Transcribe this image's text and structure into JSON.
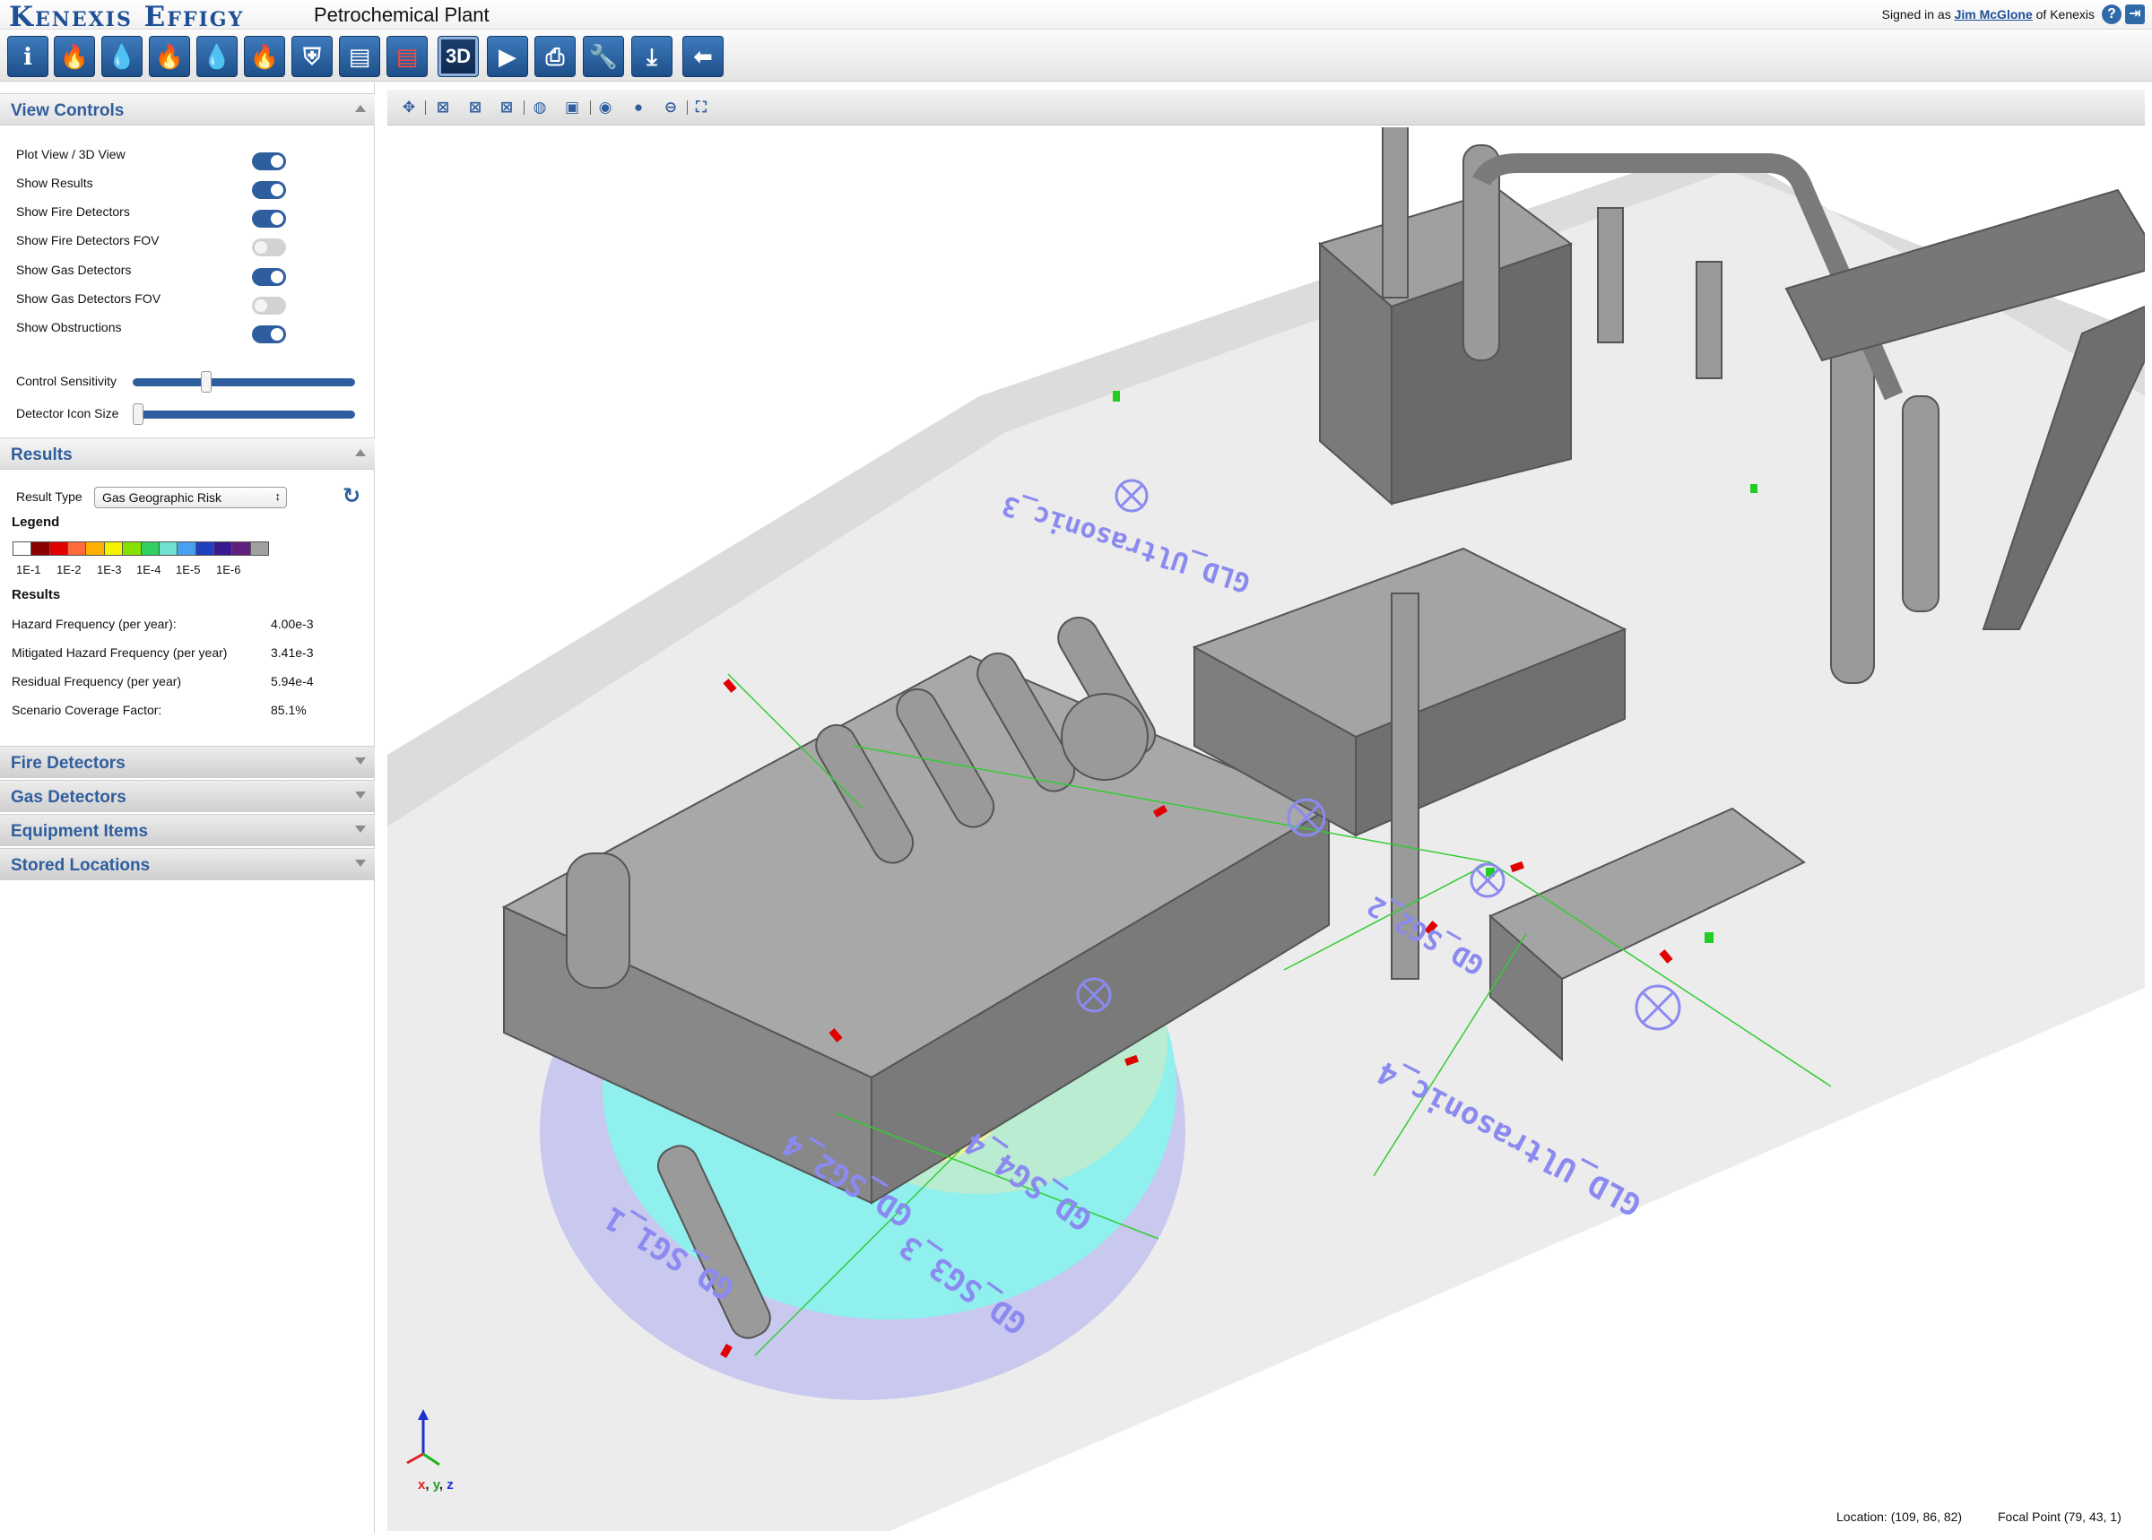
{
  "header": {
    "logo": "Kenexis Effigy",
    "app_title": "Petrochemical Plant",
    "signed_in_prefix": "Signed in as ",
    "user_name": "Jim McGlone",
    "signed_in_suffix": " of Kenexis",
    "help_icon": "?",
    "logout_icon": "⇥"
  },
  "toolbar": {
    "buttons": [
      {
        "name": "info-icon",
        "glyph": "ℹ"
      },
      {
        "name": "fire-circle-icon",
        "glyph": "🔥"
      },
      {
        "name": "gas-drop-icon",
        "glyph": "💧"
      },
      {
        "name": "fire-hazard-icon",
        "glyph": "🔥"
      },
      {
        "name": "gas-hazard-icon",
        "glyph": "💧"
      },
      {
        "name": "fire-map-icon",
        "glyph": "🔥"
      },
      {
        "name": "shield-icon",
        "glyph": "⛨"
      },
      {
        "name": "report-icon",
        "glyph": "▤"
      },
      {
        "name": "report-red-icon",
        "glyph": "▤"
      },
      {
        "name": "3d-view-icon",
        "glyph": "3D"
      },
      {
        "name": "play-icon",
        "glyph": "▶"
      },
      {
        "name": "print-icon",
        "glyph": "⎙"
      },
      {
        "name": "wrench-icon",
        "glyph": "🔧"
      },
      {
        "name": "download-icon",
        "glyph": "⤓"
      },
      {
        "name": "back-arrow-icon",
        "glyph": "⬅"
      }
    ]
  },
  "view_controls": {
    "title": "View Controls",
    "toggles": [
      {
        "label": "Plot View / 3D View",
        "on": true
      },
      {
        "label": "Show Results",
        "on": true
      },
      {
        "label": "Show Fire Detectors",
        "on": true
      },
      {
        "label": "Show Fire Detectors FOV",
        "on": false
      },
      {
        "label": "Show Gas Detectors",
        "on": true
      },
      {
        "label": "Show Gas Detectors FOV",
        "on": false
      },
      {
        "label": "Show Obstructions",
        "on": true
      }
    ],
    "control_sensitivity_label": "Control Sensitivity",
    "control_sensitivity_value": 0.32,
    "detector_icon_size_label": "Detector Icon Size",
    "detector_icon_size_value": 0.0
  },
  "results": {
    "title": "Results",
    "result_type_label": "Result Type",
    "result_type_value": "Gas Geographic Risk",
    "legend_title": "Legend",
    "legend_colors": [
      "#ffffff",
      "#8b0000",
      "#e00000",
      "#ff6a3c",
      "#ffb000",
      "#f3f300",
      "#88e000",
      "#30d060",
      "#70e0d0",
      "#4aa0f0",
      "#2040c0",
      "#3a1a90",
      "#602080",
      "#a0a0a0"
    ],
    "legend_ticks": [
      "1E-1",
      "1E-2",
      "1E-3",
      "1E-4",
      "1E-5",
      "1E-6"
    ],
    "results_heading": "Results",
    "rows": [
      {
        "label": "Hazard Frequency (per year):",
        "value": "4.00e-3"
      },
      {
        "label": "Mitigated Hazard Frequency (per year)",
        "value": "3.41e-3"
      },
      {
        "label": "Residual Frequency (per year)",
        "value": "5.94e-4"
      },
      {
        "label": "Scenario Coverage Factor:",
        "value": "85.1%"
      }
    ]
  },
  "collapsed_sections": [
    "Fire Detectors",
    "Gas Detectors",
    "Equipment Items",
    "Stored Locations"
  ],
  "viewport": {
    "tools": [
      "pan-icon",
      "view-x-icon",
      "view-y-icon",
      "view-z-icon",
      "globe-icon",
      "camera-icon",
      "target-icon",
      "person-icon",
      "minus-circle-icon",
      "fit-view-icon"
    ],
    "detector_labels": [
      "GLD_Ultrasonic_3",
      "GLD_Ultrasonic_4",
      "GD_SG2_2",
      "GD_SG4_4",
      "GD_SG2_4",
      "GD_SG1_1",
      "GD_SG3_3"
    ],
    "axis_label": "x, y, z",
    "location": "Location: (109, 86, 82)",
    "focal_point": "Focal Point (79, 43, 1)"
  },
  "colors": {
    "accent": "#2f5e9e",
    "hazard_cyan": "#8ff0ee",
    "hazard_yellow": "#f6f39a",
    "hazard_lavender": "#c9c8ee",
    "equipment_gray": "#9a9a9a"
  }
}
